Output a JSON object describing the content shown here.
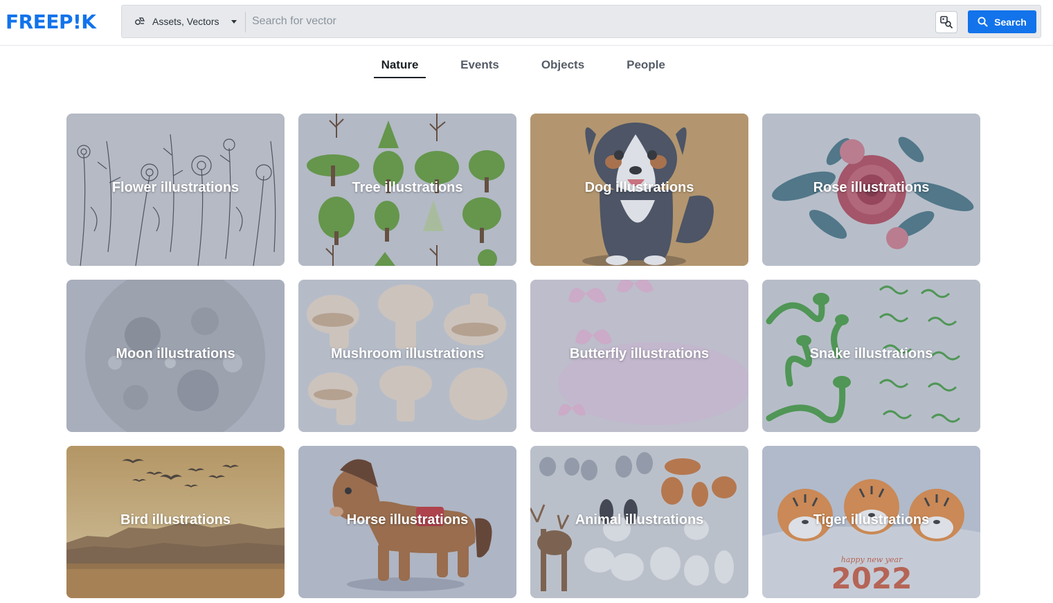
{
  "header": {
    "logo_text": "FREEP!K",
    "asset_type": "Assets, Vectors",
    "search_placeholder": "Search for vector",
    "search_button": "Search"
  },
  "tabs": [
    {
      "label": "Nature",
      "active": true
    },
    {
      "label": "Events",
      "active": false
    },
    {
      "label": "Objects",
      "active": false
    },
    {
      "label": "People",
      "active": false
    }
  ],
  "cards": [
    {
      "label": "Flower illustrations"
    },
    {
      "label": "Tree illustrations"
    },
    {
      "label": "Dog illustrations"
    },
    {
      "label": "Rose illustrations"
    },
    {
      "label": "Moon illustrations"
    },
    {
      "label": "Mushroom illustrations"
    },
    {
      "label": "Butterfly illustrations"
    },
    {
      "label": "Snake illustrations"
    },
    {
      "label": "Bird illustrations"
    },
    {
      "label": "Horse illustrations"
    },
    {
      "label": "Animal illustrations"
    },
    {
      "label": "Tiger illustrations",
      "year_text": "2022",
      "script_text": "happy new year"
    }
  ],
  "colors": {
    "brand_blue": "#1273eb",
    "tab_active": "#1a1f24",
    "tab_inactive": "#555c66"
  }
}
